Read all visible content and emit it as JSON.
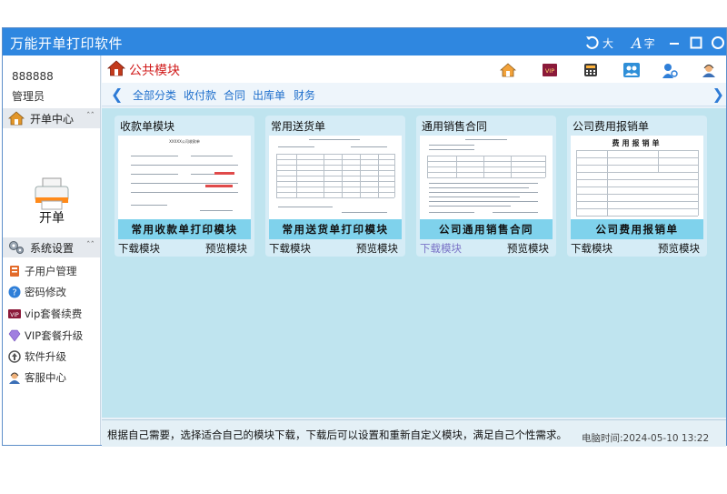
{
  "app": {
    "title": "万能开单打印软件"
  },
  "titlebar": {
    "font_big": "大",
    "font_char": "字",
    "minimize": "—"
  },
  "user": {
    "id": "888888",
    "role": "管理员"
  },
  "sidebar": {
    "sections": [
      {
        "label": "开单中心",
        "icon": "home-icon"
      },
      {
        "label": "系统设置",
        "icon": "gears-icon"
      }
    ],
    "kaidan_label": "开单",
    "items": [
      {
        "label": "子用户管理",
        "icon": "user-manage-icon"
      },
      {
        "label": "密码修改",
        "icon": "question-icon"
      },
      {
        "label": "vip套餐续费",
        "icon": "vip-icon"
      },
      {
        "label": "VIP套餐升级",
        "icon": "diamond-icon"
      },
      {
        "label": "软件升级",
        "icon": "upgrade-icon"
      },
      {
        "label": "客服中心",
        "icon": "support-icon"
      }
    ]
  },
  "main": {
    "title": "公共模块",
    "header_icons": [
      "home-icon",
      "vip-icon",
      "calculator-icon",
      "users-icon",
      "user-key-icon",
      "support-icon"
    ],
    "tabs": [
      "全部分类",
      "收付款",
      "合同",
      "出库单",
      "财务"
    ],
    "cards": [
      {
        "title": "收款单模块",
        "band": "常用收款单打印模块",
        "download": "下载模块",
        "preview": "预览模块",
        "doc_title": "XXXXX公司收款单"
      },
      {
        "title": "常用送货单",
        "band": "常用送货单打印模块",
        "download": "下载模块",
        "preview": "预览模块",
        "doc_title": ""
      },
      {
        "title": "通用销售合同",
        "band": "公司通用销售合同",
        "download": "下载模块",
        "preview": "预览模块",
        "doc_title": ""
      },
      {
        "title": "公司费用报销单",
        "band": "公司费用报销单",
        "download": "下载模块",
        "preview": "预览模块",
        "doc_title": "费用报销单"
      }
    ],
    "notice": "根据自己需要，选择适合自己的模块下载，下载后可以设置和重新自定义模块，满足自己个性需求。"
  },
  "status": {
    "time_label": "电脑时间:2024-05-10 13:22"
  },
  "colors": {
    "titlebar": "#2f87e0",
    "accent_red": "#d01a1a",
    "link_blue": "#1f6fcc",
    "band": "#7fd2ec"
  }
}
